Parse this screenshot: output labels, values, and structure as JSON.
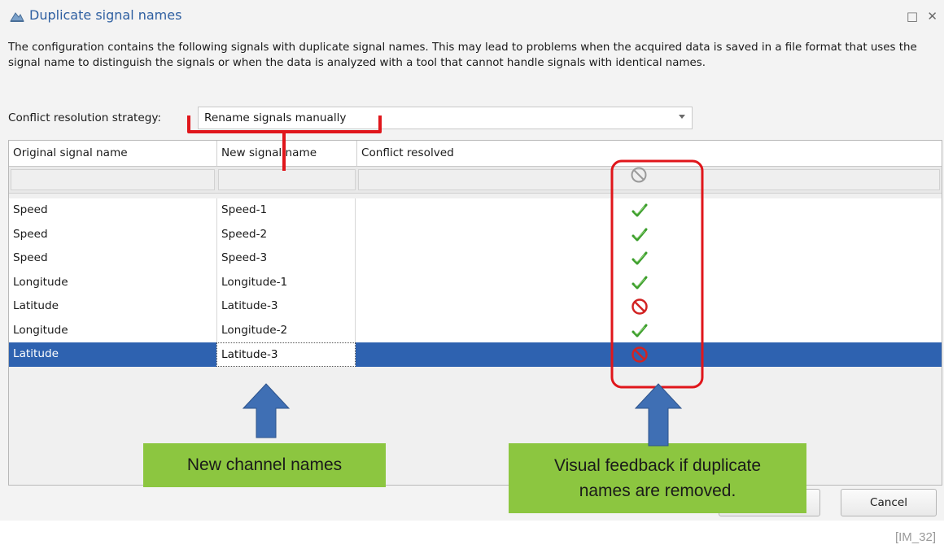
{
  "window": {
    "title": "Duplicate signal names"
  },
  "description": "The configuration contains the following signals with duplicate signal names. This may lead to problems when the acquired data is saved in a file format that uses the signal name to distinguish the signals or when the data is analyzed with a tool that cannot handle signals with identical names.",
  "strategy": {
    "label": "Conflict resolution strategy:",
    "value": "Rename signals manually"
  },
  "grid": {
    "columns": [
      "Original signal name",
      "New signal name",
      "Conflict resolved"
    ],
    "filter_icon": "not-allowed-icon",
    "rows": [
      {
        "original": "Speed",
        "new": "Speed-1",
        "status_icon": "check-icon",
        "resolved": true
      },
      {
        "original": "Speed",
        "new": "Speed-2",
        "status_icon": "check-icon",
        "resolved": true
      },
      {
        "original": "Speed",
        "new": "Speed-3",
        "status_icon": "check-icon",
        "resolved": true
      },
      {
        "original": "Longitude",
        "new": "Longitude-1",
        "status_icon": "check-icon",
        "resolved": true
      },
      {
        "original": "Latitude",
        "new": "Latitude-3",
        "status_icon": "not-allowed-icon",
        "resolved": false
      },
      {
        "original": "Longitude",
        "new": "Longitude-2",
        "status_icon": "check-icon",
        "resolved": true
      },
      {
        "original": "Latitude",
        "new": "Latitude-3",
        "status_icon": "not-allowed-icon",
        "resolved": false,
        "selected": true,
        "editing": true
      }
    ]
  },
  "buttons": {
    "cancel": "Cancel"
  },
  "annotations": {
    "left_callout": "New channel names",
    "right_callout_line1": "Visual feedback if duplicate",
    "right_callout_line2": "names are removed."
  },
  "watermark": "[IM_32]",
  "colors": {
    "title": "#2e5fa1",
    "selection": "#2e62b0",
    "callout_fill": "#8cc640",
    "highlight_red": "#e0161b",
    "arrow_blue": "#3f6fb4",
    "check_green": "#3c9e2c",
    "prohibit_red": "#d22323"
  }
}
